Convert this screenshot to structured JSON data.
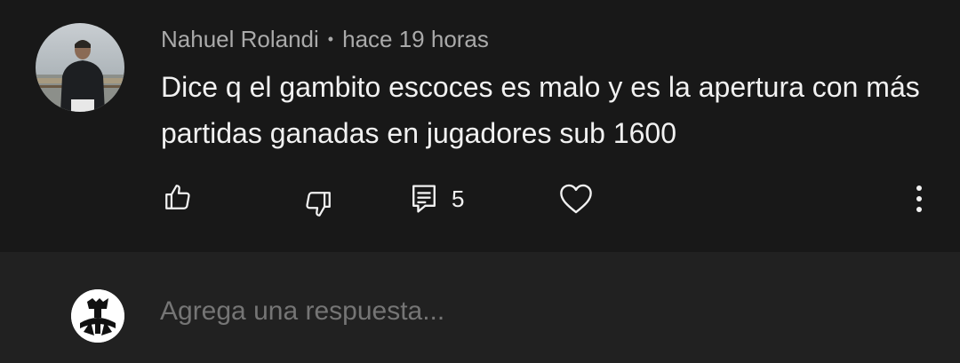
{
  "comment": {
    "author": "Nahuel Rolandi",
    "separator": "•",
    "time": "hace 19 horas",
    "text": "Dice q el gambito escoces es malo y es la apertura con más partidas ganadas en jugadores sub 1600",
    "actions": {
      "like_icon": "thumbs-up-icon",
      "dislike_icon": "thumbs-down-icon",
      "reply_icon": "reply-icon",
      "reply_count": "5",
      "heart_icon": "heart-icon",
      "more_icon": "more-vertical-icon"
    }
  },
  "reply_box": {
    "placeholder": "Agrega una respuesta..."
  },
  "colors": {
    "background": "#181818",
    "reply_bar": "#212121",
    "text_primary": "#f1f1f1",
    "text_secondary": "#aaaaaa",
    "placeholder": "#7d7d7d"
  }
}
